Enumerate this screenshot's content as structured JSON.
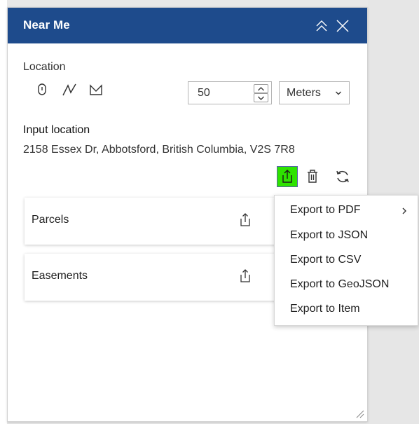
{
  "panel": {
    "title": "Near Me",
    "collapse_icon": "double-chevron-up-icon",
    "close_icon": "close-icon"
  },
  "location": {
    "label": "Location",
    "tools": [
      "point-icon",
      "polyline-icon",
      "polygon-icon"
    ],
    "distance": {
      "value": "50"
    },
    "unit": {
      "selected": "Meters"
    }
  },
  "input_location": {
    "title": "Input location",
    "address": "2158 Essex Dr, Abbotsford, British Columbia, V2S 7R8"
  },
  "actions": [
    "export-icon",
    "trash-icon",
    "refresh-icon"
  ],
  "layers": [
    {
      "label": "Parcels"
    },
    {
      "label": "Easements"
    }
  ],
  "export_menu": {
    "items": [
      {
        "label": "Export to PDF",
        "has_submenu": true
      },
      {
        "label": "Export to JSON"
      },
      {
        "label": "Export to CSV"
      },
      {
        "label": "Export to GeoJSON"
      },
      {
        "label": "Export to Item"
      }
    ]
  },
  "colors": {
    "header": "#1e4b8c",
    "export_active": "#2ee300"
  }
}
